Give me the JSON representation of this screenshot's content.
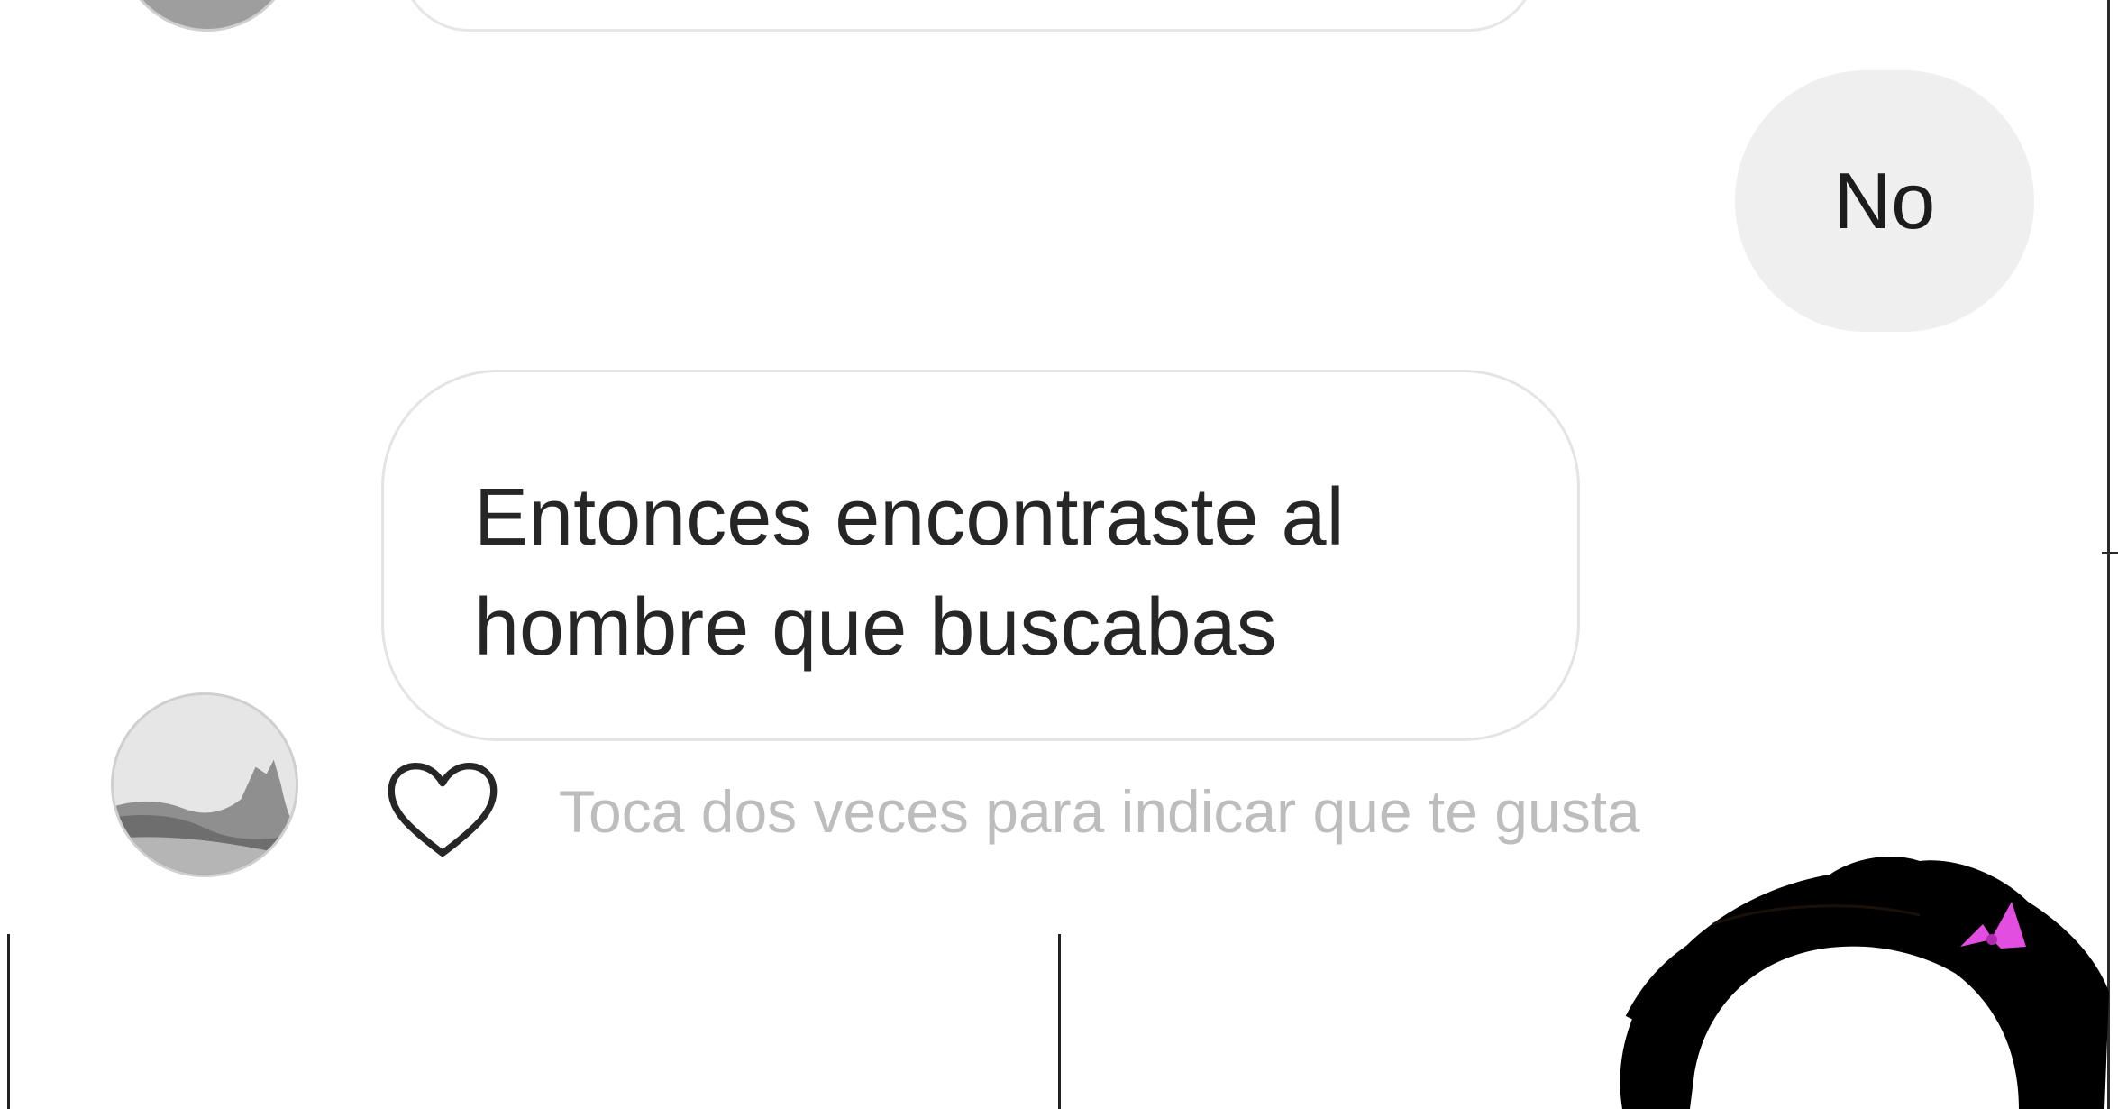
{
  "chat": {
    "messages": [
      {
        "direction": "outgoing",
        "text": "No"
      },
      {
        "direction": "incoming",
        "text": "Entonces encontraste al hombre que buscabas"
      }
    ],
    "like_hint": "Toca dos veces para indicar que te gusta"
  },
  "icons": {
    "like": "heart-outline-icon"
  },
  "colors": {
    "outgoing_bubble": "#efefef",
    "incoming_bubble_border": "#e4e4e4",
    "hint_text": "#bdbdbd",
    "bow": "#e24fe0"
  }
}
